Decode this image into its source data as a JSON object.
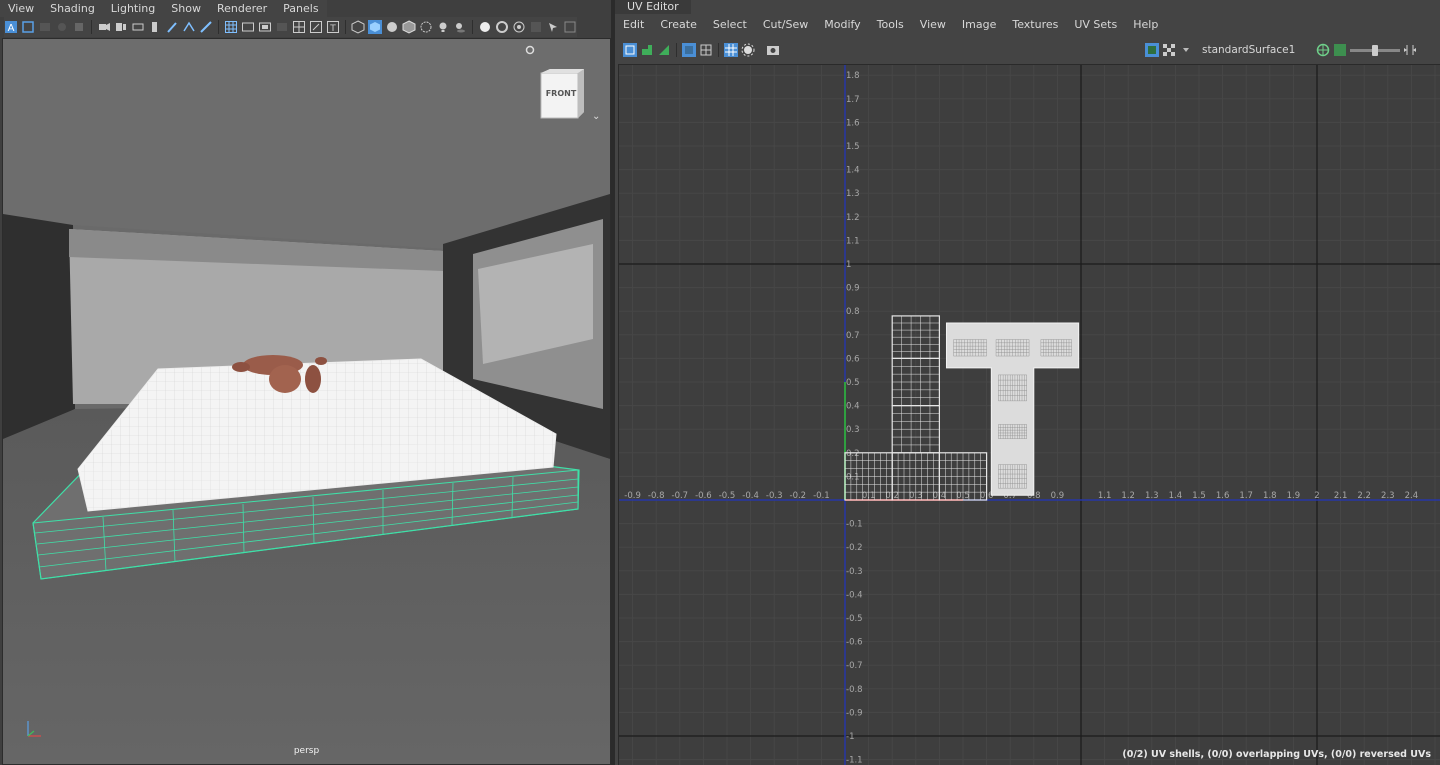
{
  "viewport": {
    "menu": [
      "View",
      "Shading",
      "Lighting",
      "Show",
      "Renderer",
      "Panels"
    ],
    "camera_label": "persp",
    "viewcube_face": "FRONT",
    "colors": {
      "wire_green": "#3fe0a8",
      "mattress_white": "#f4f4f4",
      "figure": "#9a5c4a"
    }
  },
  "uv_editor": {
    "tab_title": "UV Editor",
    "menu": [
      "Edit",
      "Create",
      "Select",
      "Cut/Sew",
      "Modify",
      "Tools",
      "View",
      "Image",
      "Textures",
      "UV Sets",
      "Help"
    ],
    "material_name": "standardSurface1",
    "status_text": "(0/2) UV shells, (0/0) overlapping UVs, (0/0) reversed UVs",
    "axis_labels_u": [
      "-0.9",
      "-0.8",
      "-0.7",
      "-0.6",
      "-0.5",
      "-0.4",
      "-0.3",
      "-0.2",
      "-0.1",
      "0.1",
      "0.2",
      "0.3",
      "0.4",
      "0.5",
      "0.6",
      "0.7",
      "0.8",
      "0.9",
      "1.1",
      "1.2",
      "1.3",
      "1.4",
      "1.5",
      "1.6",
      "1.7",
      "1.8",
      "1.9",
      "2",
      "2.1",
      "2.2",
      "2.3",
      "2.4"
    ],
    "axis_labels_v": [
      "1.8",
      "1.7",
      "1.6",
      "1.5",
      "1.4",
      "1.3",
      "1.2",
      "1.1",
      "1",
      "0.9",
      "0.8",
      "0.7",
      "0.6",
      "0.5",
      "0.4",
      "0.3",
      "0.2",
      "0.1",
      "-0.1",
      "-0.2",
      "-0.3",
      "-0.4",
      "-0.5",
      "-0.6",
      "-0.7",
      "-0.8",
      "-0.9",
      "-1",
      "-1.1"
    ],
    "colors": {
      "axis_u": "#2636a6",
      "axis_v": "#2636a6",
      "uv_shell": "#e6e6e6"
    }
  }
}
